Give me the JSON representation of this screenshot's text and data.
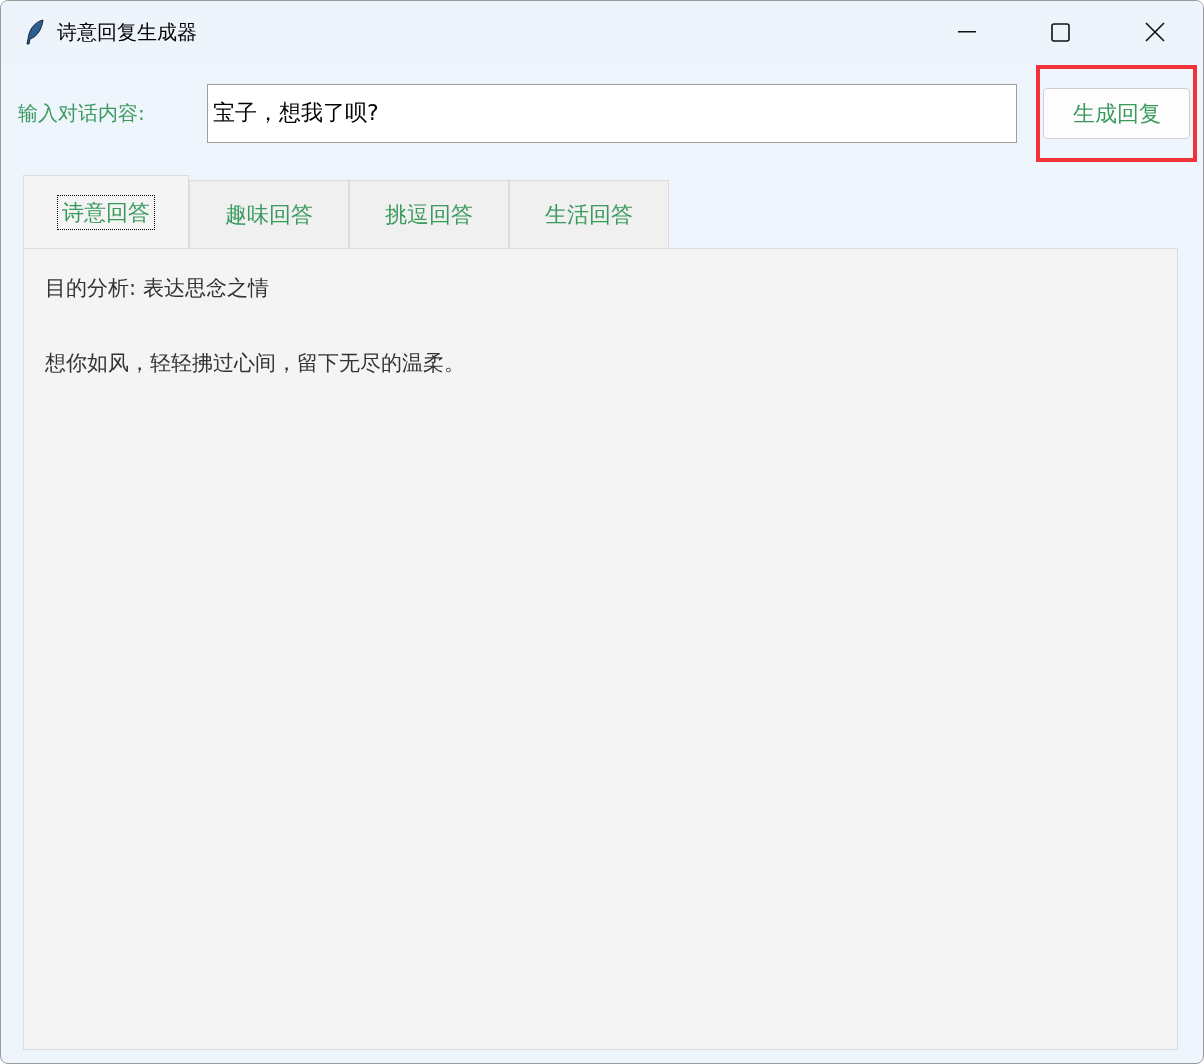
{
  "window": {
    "title": "诗意回复生成器"
  },
  "input": {
    "label": "输入对话内容:",
    "value": "宝子，想我了呗?"
  },
  "generate_button": {
    "label": "生成回复",
    "highlighted": true
  },
  "tabs": [
    {
      "label": "诗意回答",
      "selected": true
    },
    {
      "label": "趣味回答",
      "selected": false
    },
    {
      "label": "挑逗回答",
      "selected": false
    },
    {
      "label": "生活回答",
      "selected": false
    }
  ],
  "content": {
    "analysis": "目的分析: 表达思念之情",
    "reply": "想你如风，轻轻拂过心间，留下无尽的温柔。"
  }
}
